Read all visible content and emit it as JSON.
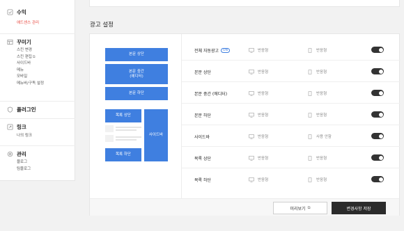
{
  "sidebar": {
    "revenue": {
      "title": "수익",
      "items": [
        "애드센스 관리"
      ]
    },
    "decorate": {
      "title": "꾸미기",
      "items": [
        "스킨 변경",
        "스킨 편집",
        "사이드바",
        "메뉴",
        "모바일",
        "메뉴바/구독 설정"
      ]
    },
    "plugin": {
      "title": "플러그인"
    },
    "link": {
      "title": "링크",
      "items": [
        "나의 링크"
      ]
    },
    "manage": {
      "title": "관리",
      "items": [
        "블로그",
        "팀블로그"
      ]
    }
  },
  "section_title": "광고 설정",
  "preview": {
    "body_top": "본문 상단",
    "body_mid": "본문 중간\n(에디터)",
    "body_bottom": "본문 하단",
    "list_top": "목록 상단",
    "list_bottom": "목록 하단",
    "sidebar": "사이드바"
  },
  "rows": [
    {
      "name": "전체 자동광고",
      "badge": "ON",
      "opt1": "반응형",
      "opt2": "반응형"
    },
    {
      "name": "본문 상단",
      "opt1": "반응형",
      "opt2": "반응형"
    },
    {
      "name": "본문 중간 (에디터)",
      "opt1": "반응형",
      "opt2": "반응형"
    },
    {
      "name": "본문 하단",
      "opt1": "반응형",
      "opt2": "반응형"
    },
    {
      "name": "사이드바",
      "opt1": "반응형",
      "opt2": "사용 안함"
    },
    {
      "name": "목록 상단",
      "opt1": "반응형",
      "opt2": "반응형"
    },
    {
      "name": "목록 하단",
      "opt1": "반응형",
      "opt2": "반응형"
    }
  ],
  "buttons": {
    "preview": "미리보기",
    "save": "변경사항 저장"
  },
  "icons": {
    "desktop": "desktop-icon",
    "mobile": "mobile-icon",
    "external": "external-link-icon"
  },
  "colors": {
    "accent_blue": "#3f7fe0",
    "active_red": "#e8453c",
    "toggle_on": "#333333"
  }
}
